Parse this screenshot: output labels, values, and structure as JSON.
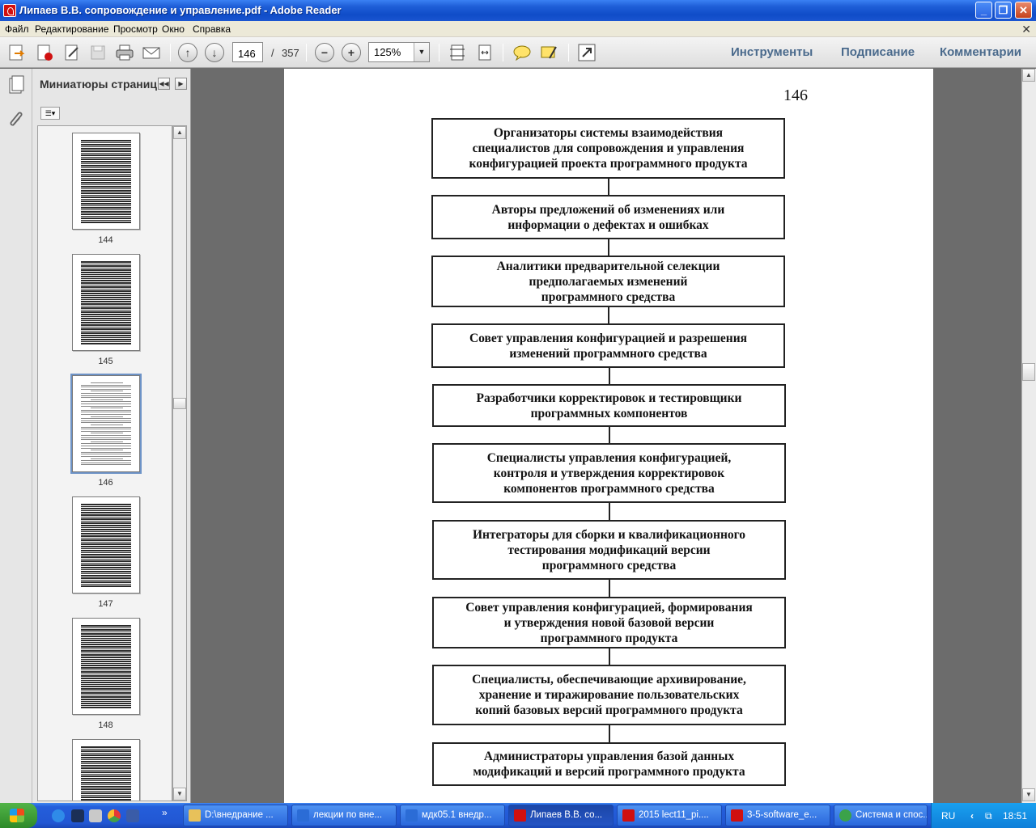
{
  "window": {
    "title": "Липаев В.В. сопровождение и управление.pdf - Adobe Reader"
  },
  "menu": [
    "Файл",
    "Редактирование",
    "Просмотр",
    "Окно",
    "Справка"
  ],
  "toolbar": {
    "current_page": "146",
    "page_separator": "/",
    "total_pages": "357",
    "zoom": "125%",
    "tabs": [
      "Инструменты",
      "Подписание",
      "Комментарии"
    ]
  },
  "nav_panel": {
    "title": "Миниатюры страниц",
    "thumbnails": [
      {
        "label": "144"
      },
      {
        "label": "145"
      },
      {
        "label": "146",
        "selected": true
      },
      {
        "label": "147"
      },
      {
        "label": "148"
      },
      {
        "label": ""
      }
    ]
  },
  "document": {
    "page_number": "146",
    "boxes": [
      "Организаторы системы взаимодействия\nспециалистов для сопровождения и управления\nконфигурацией проекта программного продукта",
      "Авторы предложений об изменениях или\nинформации о дефектах и ошибках",
      "Аналитики предварительной селекции\nпредполагаемых изменений\nпрограммного средства",
      "Совет управления конфигурацией и разрешения\nизменений программного средства",
      "Разработчики корректировок и тестировщики\nпрограммных компонентов",
      "Специалисты управления конфигурацией,\nконтроля и утверждения корректировок\nкомпонентов программного средства",
      "Интеграторы для сборки и квалификационного\nтестирования модификаций версии\nпрограммного средства",
      "Совет управления конфигурацией, формирования\nи утверждения новой базовой версии\nпрограммного продукта",
      "Специалисты, обеспечивающие архивирование,\nхранение и тиражирование пользовательских\nкопий базовых версий программного продукта",
      "Администраторы управления базой данных\nмодификаций и версий программного продукта"
    ]
  },
  "taskbar": {
    "tasks": [
      {
        "label": "D:\\внедрание ...",
        "color": "#e8c15a"
      },
      {
        "label": "лекции по вне...",
        "color": "#2b6cd6"
      },
      {
        "label": "мдк05.1 внедр...",
        "color": "#2b6cd6"
      },
      {
        "label": "Липаев В.В. со...",
        "color": "#d01010",
        "active": true
      },
      {
        "label": "2015 lect11_pi....",
        "color": "#d01010"
      },
      {
        "label": "3-5-software_e...",
        "color": "#d01010"
      },
      {
        "label": "Система и спос...",
        "color": "#3ba24a"
      }
    ],
    "lang": "RU",
    "clock": "18:51"
  }
}
